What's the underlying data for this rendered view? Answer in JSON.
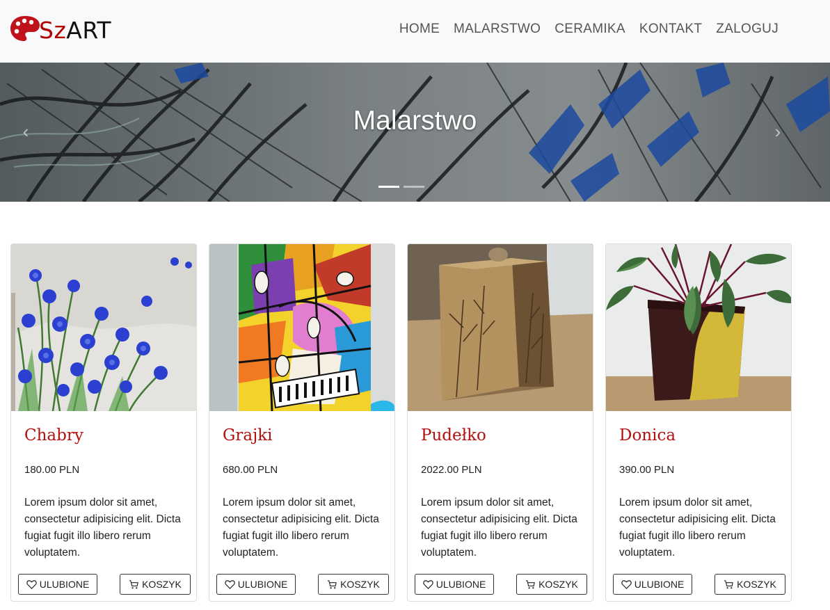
{
  "brand": {
    "prefix": "Sz",
    "suffix": "ART",
    "logo_icon": "palette-icon"
  },
  "nav": {
    "items": [
      {
        "label": "HOME"
      },
      {
        "label": "MALARSTWO"
      },
      {
        "label": "CERAMIKA"
      },
      {
        "label": "KONTAKT"
      },
      {
        "label": "ZALOGUJ"
      }
    ]
  },
  "hero": {
    "title": "Malarstwo",
    "prev_icon": "chevron-left-icon",
    "next_icon": "chevron-right-icon",
    "slides_count": 2,
    "active_slide": 1
  },
  "products": [
    {
      "title": "Chabry",
      "price": "180.00 PLN",
      "description": "Lorem ipsum dolor sit amet, consectetur adipisicing elit. Dicta fugiat fugit illo libero rerum voluptatem.",
      "fav_label": "ULUBIONE",
      "cart_label": "KOSZYK"
    },
    {
      "title": "Grajki",
      "price": "680.00 PLN",
      "description": "Lorem ipsum dolor sit amet, consectetur adipisicing elit. Dicta fugiat fugit illo libero rerum voluptatem.",
      "fav_label": "ULUBIONE",
      "cart_label": "KOSZYK"
    },
    {
      "title": "Pudełko",
      "price": "2022.00 PLN",
      "description": "Lorem ipsum dolor sit amet, consectetur adipisicing elit. Dicta fugiat fugit illo libero rerum voluptatem.",
      "fav_label": "ULUBIONE",
      "cart_label": "KOSZYK"
    },
    {
      "title": "Donica",
      "price": "390.00 PLN",
      "description": "Lorem ipsum dolor sit amet, consectetur adipisicing elit. Dicta fugiat fugit illo libero rerum voluptatem.",
      "fav_label": "ULUBIONE",
      "cart_label": "KOSZYK"
    }
  ],
  "colors": {
    "accent": "#b31010",
    "navbar_bg": "#f8f9fa"
  }
}
